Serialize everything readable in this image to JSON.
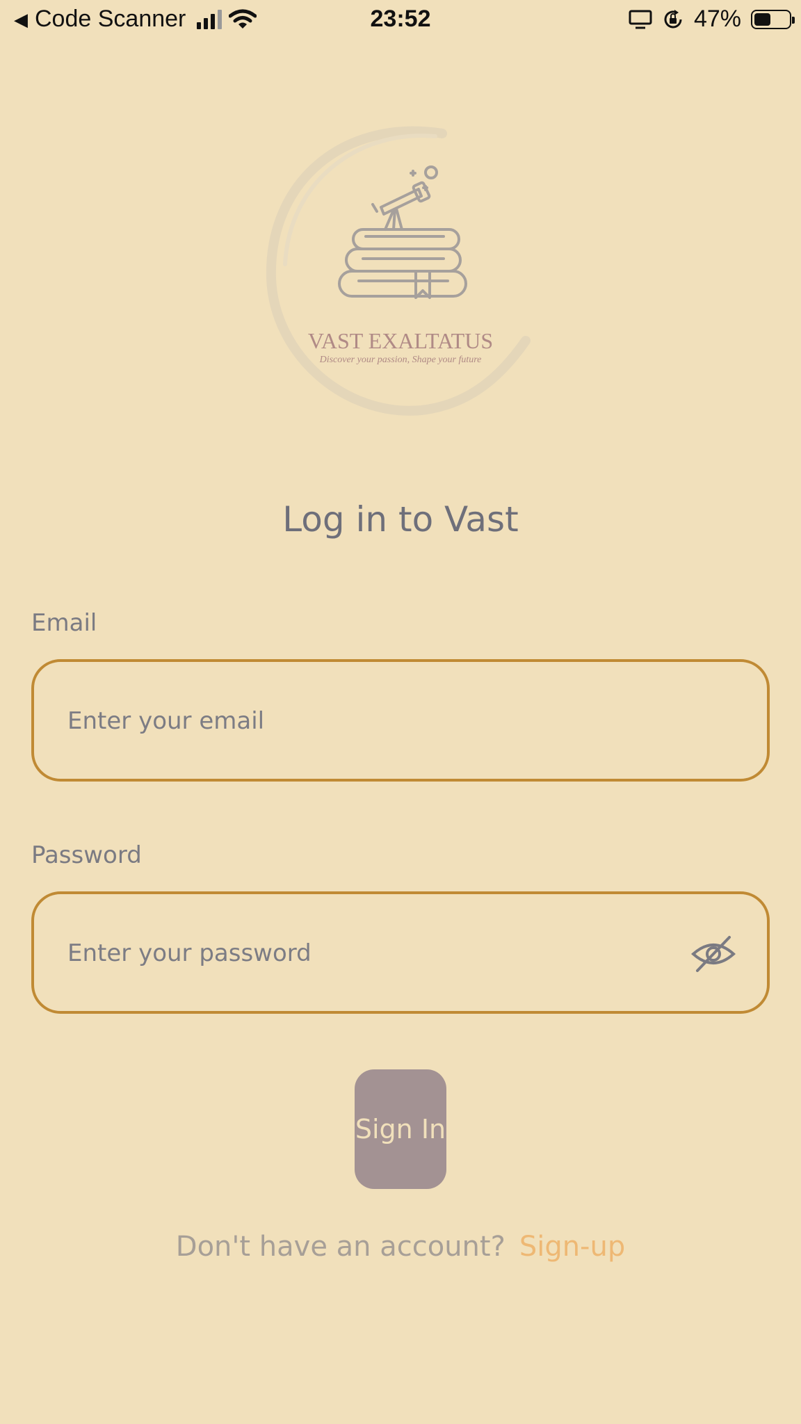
{
  "status_bar": {
    "back_app": "Code Scanner",
    "time": "23:52",
    "battery_percent": "47%",
    "battery_level": 0.47,
    "icons": [
      "back-arrow-icon",
      "signal-icon",
      "wifi-icon",
      "screen-mirroring-icon",
      "orientation-lock-icon",
      "battery-icon"
    ]
  },
  "logo": {
    "title": "VAST EXALTATUS",
    "tagline": "Discover your passion, Shape your future",
    "icon": "telescope-on-books-icon"
  },
  "login": {
    "title": "Log in to Vast",
    "email_label": "Email",
    "email_placeholder": "Enter your email",
    "email_value": "",
    "password_label": "Password",
    "password_placeholder": "Enter your password",
    "password_value": "",
    "password_toggle_icon": "eye-slash-icon",
    "signin_label": "Sign In",
    "signup_prompt": "Don't have an account?",
    "signup_link": "Sign-up"
  },
  "colors": {
    "background": "#f1e0bb",
    "field_border": "#c08a34",
    "button": "#a39293",
    "link": "#eeb874",
    "text": "#6e6f7a"
  }
}
